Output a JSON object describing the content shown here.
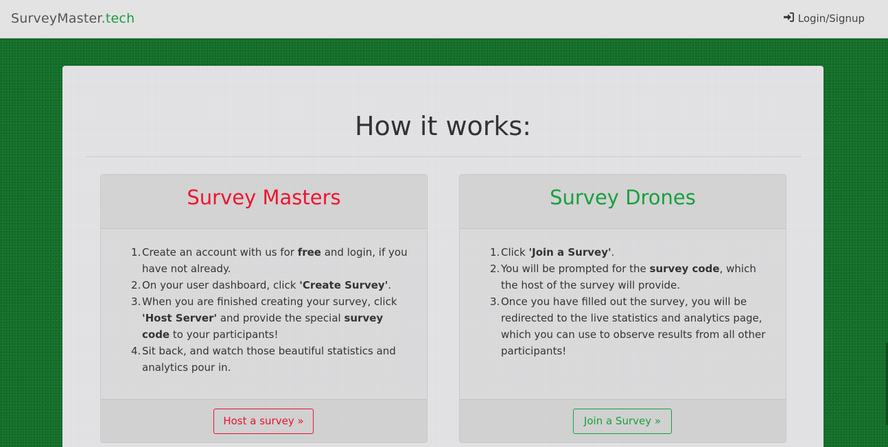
{
  "navbar": {
    "brand_main": "SurveyMaster",
    "brand_accent": ".tech",
    "login_label": "Login/Signup",
    "login_icon": "sign-in-icon"
  },
  "main": {
    "heading": "How it works:"
  },
  "masters": {
    "title": "Survey Masters",
    "color": "#f0142e",
    "steps": [
      {
        "n": "1.",
        "parts": [
          {
            "t": "Create an account with us for "
          },
          {
            "t": "free",
            "b": true
          },
          {
            "t": " and login, if you have not already."
          }
        ]
      },
      {
        "n": "2.",
        "parts": [
          {
            "t": "On your user dashboard, click "
          },
          {
            "t": "'Create Survey'",
            "b": true
          },
          {
            "t": "."
          }
        ]
      },
      {
        "n": "3.",
        "parts": [
          {
            "t": "When you are finished creating your survey, click "
          },
          {
            "t": "'Host Server'",
            "b": true
          },
          {
            "t": " and provide the special "
          },
          {
            "t": "survey code",
            "b": true
          },
          {
            "t": " to your participants!"
          }
        ]
      },
      {
        "n": "4.",
        "parts": [
          {
            "t": "Sit back, and watch those beautiful statistics and analytics pour in."
          }
        ]
      }
    ],
    "button_label": "Host a survey »"
  },
  "drones": {
    "title": "Survey Drones",
    "color": "#18a03c",
    "steps": [
      {
        "n": "1.",
        "parts": [
          {
            "t": "Click "
          },
          {
            "t": "'Join a Survey'",
            "b": true
          },
          {
            "t": "."
          }
        ]
      },
      {
        "n": "2.",
        "parts": [
          {
            "t": "You will be prompted for the "
          },
          {
            "t": "survey code",
            "b": true
          },
          {
            "t": ", which the host of the survey will provide."
          }
        ]
      },
      {
        "n": "3.",
        "parts": [
          {
            "t": "Once you have filled out the survey, you will be redirected to the live statistics and analytics page, which you can use to observe results from all other participants!"
          }
        ]
      }
    ],
    "button_label": "Join a Survey »"
  }
}
